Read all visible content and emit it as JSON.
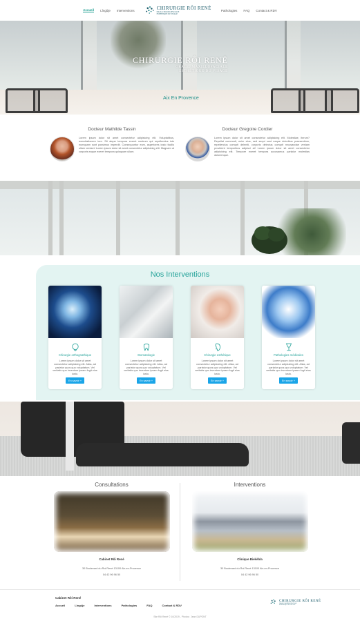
{
  "brand": {
    "title": "CHIRURGIE RÔI RENÉ",
    "subtitle_1": "ORALE, MAXILLOFACIALE",
    "subtitle_2": "ESTHÉTIQUE DU VISAGE",
    "city": "Aix En Provence",
    "accent_color": "#26a39a",
    "button_color": "#1aa5e8"
  },
  "nav": {
    "left": [
      {
        "label": "Accueil",
        "active": true
      },
      {
        "label": "Lîngûje",
        "active": false
      },
      {
        "label": "Interventions",
        "active": false
      }
    ],
    "right": [
      {
        "label": "Pathologies",
        "active": false
      },
      {
        "label": "FAQ",
        "active": false
      },
      {
        "label": "Contact & RDV",
        "active": false
      }
    ]
  },
  "doctors": [
    {
      "name": "Docteur Mathilde Tassin",
      "text": "Lorem ipsum dolor sit amet consectetur adipisicing elit. Voluptatibus, exercitationem iure. Sit atque tempora exeret nostrum qui repellendus iste numquam sunt possimus imperdit. Consequuntur eum, asperiores iusto facilis ullam veniam! Lorem ipsum dolor sit amet consectetur adipisicing elit. Magnam ut corporis eaque exeret tempora quisquam ullam."
    },
    {
      "name": "Docteur Gregoire Cordier",
      "text": "Lorem ipsum dolor sit amet consectetur adipisicing elit. Molestiae, iterum? Repellat commodi, enim eius, sed sequi sunt eaque doloribus praesentium, repellendus corrupti deleniti, corporis delectus corrupti recusandae veniam provident temporibus adipisci at! Lorem ipsum dolor sit amet consectetur adipisicing elit. Tempore exeret tempora accusamus pariatur molestias doloremque."
    }
  ],
  "interventions": {
    "title": "Nos Interventions",
    "cards": [
      {
        "label": "Chirurgie orthognathique",
        "icon": "tooth-face-icon",
        "text": "Lorem ipsum dolor sit amet consectetur adipisicing elit. Alias, ad pariatur quos quo voluptatum. Vel veritatis quo inventore ipsam fugit eius iusto.",
        "button": "En savoir +"
      },
      {
        "label": "Stomatologie",
        "icon": "tooth-icon",
        "text": "Lorem ipsum dolor sit amet consectetur adipisicing elit. Alias, ad pariatur quos quo voluptatum. Vel veritatis quo inventore ipsam fugit eius iusto.",
        "button": "En savoir +"
      },
      {
        "label": "Chirurgie esthétique",
        "icon": "face-icon",
        "text": "Lorem ipsum dolor sit amet consectetur adipisicing elit. Alias, ad pariatur quos quo voluptatum. Vel veritatis quo inventore ipsam fugit eius iusto.",
        "button": "En savoir +"
      },
      {
        "label": "Pathologies médicales",
        "icon": "chalice-icon",
        "text": "Lorem ipsum dolor sit amet consectetur adipisicing elit. Alias, ad pariatur quos quo voluptatum. Vel veritatis quo inventore ipsam fugit eius iusto.",
        "button": "En savoir +"
      }
    ]
  },
  "locations": [
    {
      "title": "Consultations",
      "name": "Cabinet Rôi René",
      "address": "30 Boulevard du Roi René 13100 Aix-en-Provence",
      "phone": "04 42 96 96 50"
    },
    {
      "title": "Interventions",
      "name": "Clinique Biekèbla",
      "address": "30 Boulevard du Roi René 13100 Aix-en-Provence",
      "phone": "04 42 96 96 50"
    }
  ],
  "footer": {
    "title": "Cabinet Rôi René",
    "links": [
      "Accueil",
      "Lîngûje",
      "Interventions",
      "Pathologies",
      "FAQ",
      "Contact & RDV"
    ],
    "credits": "Site Rôi René © 10/2019  -  Photos : Jean DUPONT"
  }
}
